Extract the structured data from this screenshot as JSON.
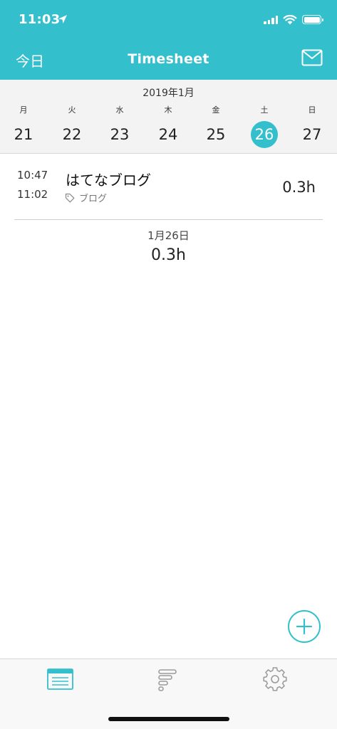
{
  "status_bar": {
    "time": "11:03"
  },
  "nav": {
    "today_label": "今日",
    "title": "Timesheet"
  },
  "week": {
    "month_label": "2019年1月",
    "days": [
      {
        "dow": "月",
        "num": "21"
      },
      {
        "dow": "火",
        "num": "22"
      },
      {
        "dow": "水",
        "num": "23"
      },
      {
        "dow": "木",
        "num": "24"
      },
      {
        "dow": "金",
        "num": "25"
      },
      {
        "dow": "土",
        "num": "26"
      },
      {
        "dow": "日",
        "num": "27"
      }
    ],
    "selected_index": 5
  },
  "entries": [
    {
      "start": "10:47",
      "end": "11:02",
      "title": "はてなブログ",
      "tag": "ブログ",
      "duration": "0.3h"
    }
  ],
  "summary": {
    "date": "1月26日",
    "total": "0.3h"
  },
  "colors": {
    "accent": "#34bfcc",
    "tab_inactive": "#9a9a9a"
  },
  "icons": {
    "nav_right": "mail-icon",
    "tag": "tag-icon",
    "add": "plus-icon",
    "tabs": [
      "timesheet-icon",
      "report-icon",
      "settings-icon"
    ]
  }
}
